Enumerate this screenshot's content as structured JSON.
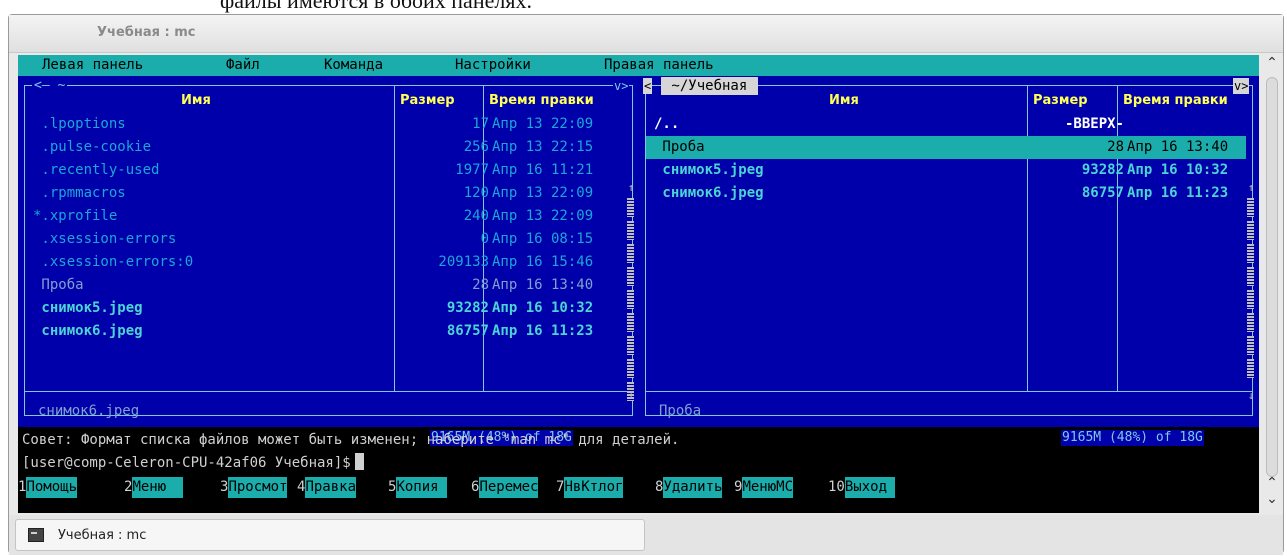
{
  "doc_fragment": "файлы имеются в обоих панелях.",
  "window": {
    "title": "Учебная : mc"
  },
  "menu": [
    "Левая панель",
    "Файл",
    "Команда",
    "Настройки",
    "Правая панель"
  ],
  "left_panel": {
    "path": "<— ~",
    "corner": "v>",
    "headers": {
      "name": "Имя",
      "size": "Размер",
      "mtime": "Время правки"
    },
    "files": [
      {
        "name": " .lpoptions",
        "size": "17",
        "mtime": "Апр 13 22:09",
        "style": "dim"
      },
      {
        "name": " .pulse-cookie",
        "size": "256",
        "mtime": "Апр 13 22:15",
        "style": "dim"
      },
      {
        "name": " .recently-used",
        "size": "1977",
        "mtime": "Апр 16 11:21",
        "style": "dim"
      },
      {
        "name": " .rpmmacros",
        "size": "120",
        "mtime": "Апр 13 22:09",
        "style": "dim"
      },
      {
        "name": "*.xprofile",
        "size": "240",
        "mtime": "Апр 13 22:09",
        "style": "dim"
      },
      {
        "name": " .xsession-errors",
        "size": "0",
        "mtime": "Апр 16 08:15",
        "style": "dim"
      },
      {
        "name": " .xsession-errors:0",
        "size": "209133",
        "mtime": "Апр 16 15:46",
        "style": "dim"
      },
      {
        "name": " Проба",
        "size": "28",
        "mtime": "Апр 16 13:40",
        "style": "plain"
      },
      {
        "name": " снимок5.jpeg",
        "size": "93282",
        "mtime": "Апр 16 10:32",
        "style": "hi"
      },
      {
        "name": " снимок6.jpeg",
        "size": "86757",
        "mtime": "Апр 16 11:23",
        "style": "hi"
      }
    ],
    "mini_status": "снимок6.jpeg",
    "free_space": "9165M (48%) of 18G"
  },
  "right_panel": {
    "left_tag": "<",
    "path": " ~/Учебная ",
    "corner": "v>",
    "headers": {
      "name": "Имя",
      "size": "Размер",
      "mtime": "Время правки"
    },
    "files": [
      {
        "name": "/..",
        "size": "-ВВЕРХ-",
        "mtime": "",
        "style": "updir"
      },
      {
        "name": " Проба",
        "size": "28",
        "mtime": "Апр 16 13:40",
        "style": "selected"
      },
      {
        "name": " снимок5.jpeg",
        "size": "93282",
        "mtime": "Апр 16 10:32",
        "style": "hi"
      },
      {
        "name": " снимок6.jpeg",
        "size": "86757",
        "mtime": "Апр 16 11:23",
        "style": "hi"
      }
    ],
    "mini_status": "Проба",
    "free_space": "9165M (48%) of 18G"
  },
  "hint": "Совет: Формат списка файлов может быть изменен; наберите \"man mc\" для деталей.",
  "prompt": "[user@comp-Celeron-CPU-42af06 Учебная]$",
  "fkeys": [
    {
      "num": "1",
      "label": "Помощь"
    },
    {
      "num": "2",
      "label": "Меню  "
    },
    {
      "num": "3",
      "label": "Просмот"
    },
    {
      "num": "4",
      "label": "Правка"
    },
    {
      "num": "5",
      "label": "Копия "
    },
    {
      "num": "6",
      "label": "Перемес"
    },
    {
      "num": "7",
      "label": "НвКтлог"
    },
    {
      "num": "8",
      "label": "Удалить"
    },
    {
      "num": "9",
      "label": "МенюМС"
    },
    {
      "num": "10",
      "label": "Выход "
    }
  ],
  "taskbar": {
    "item": "Учебная : mc"
  }
}
